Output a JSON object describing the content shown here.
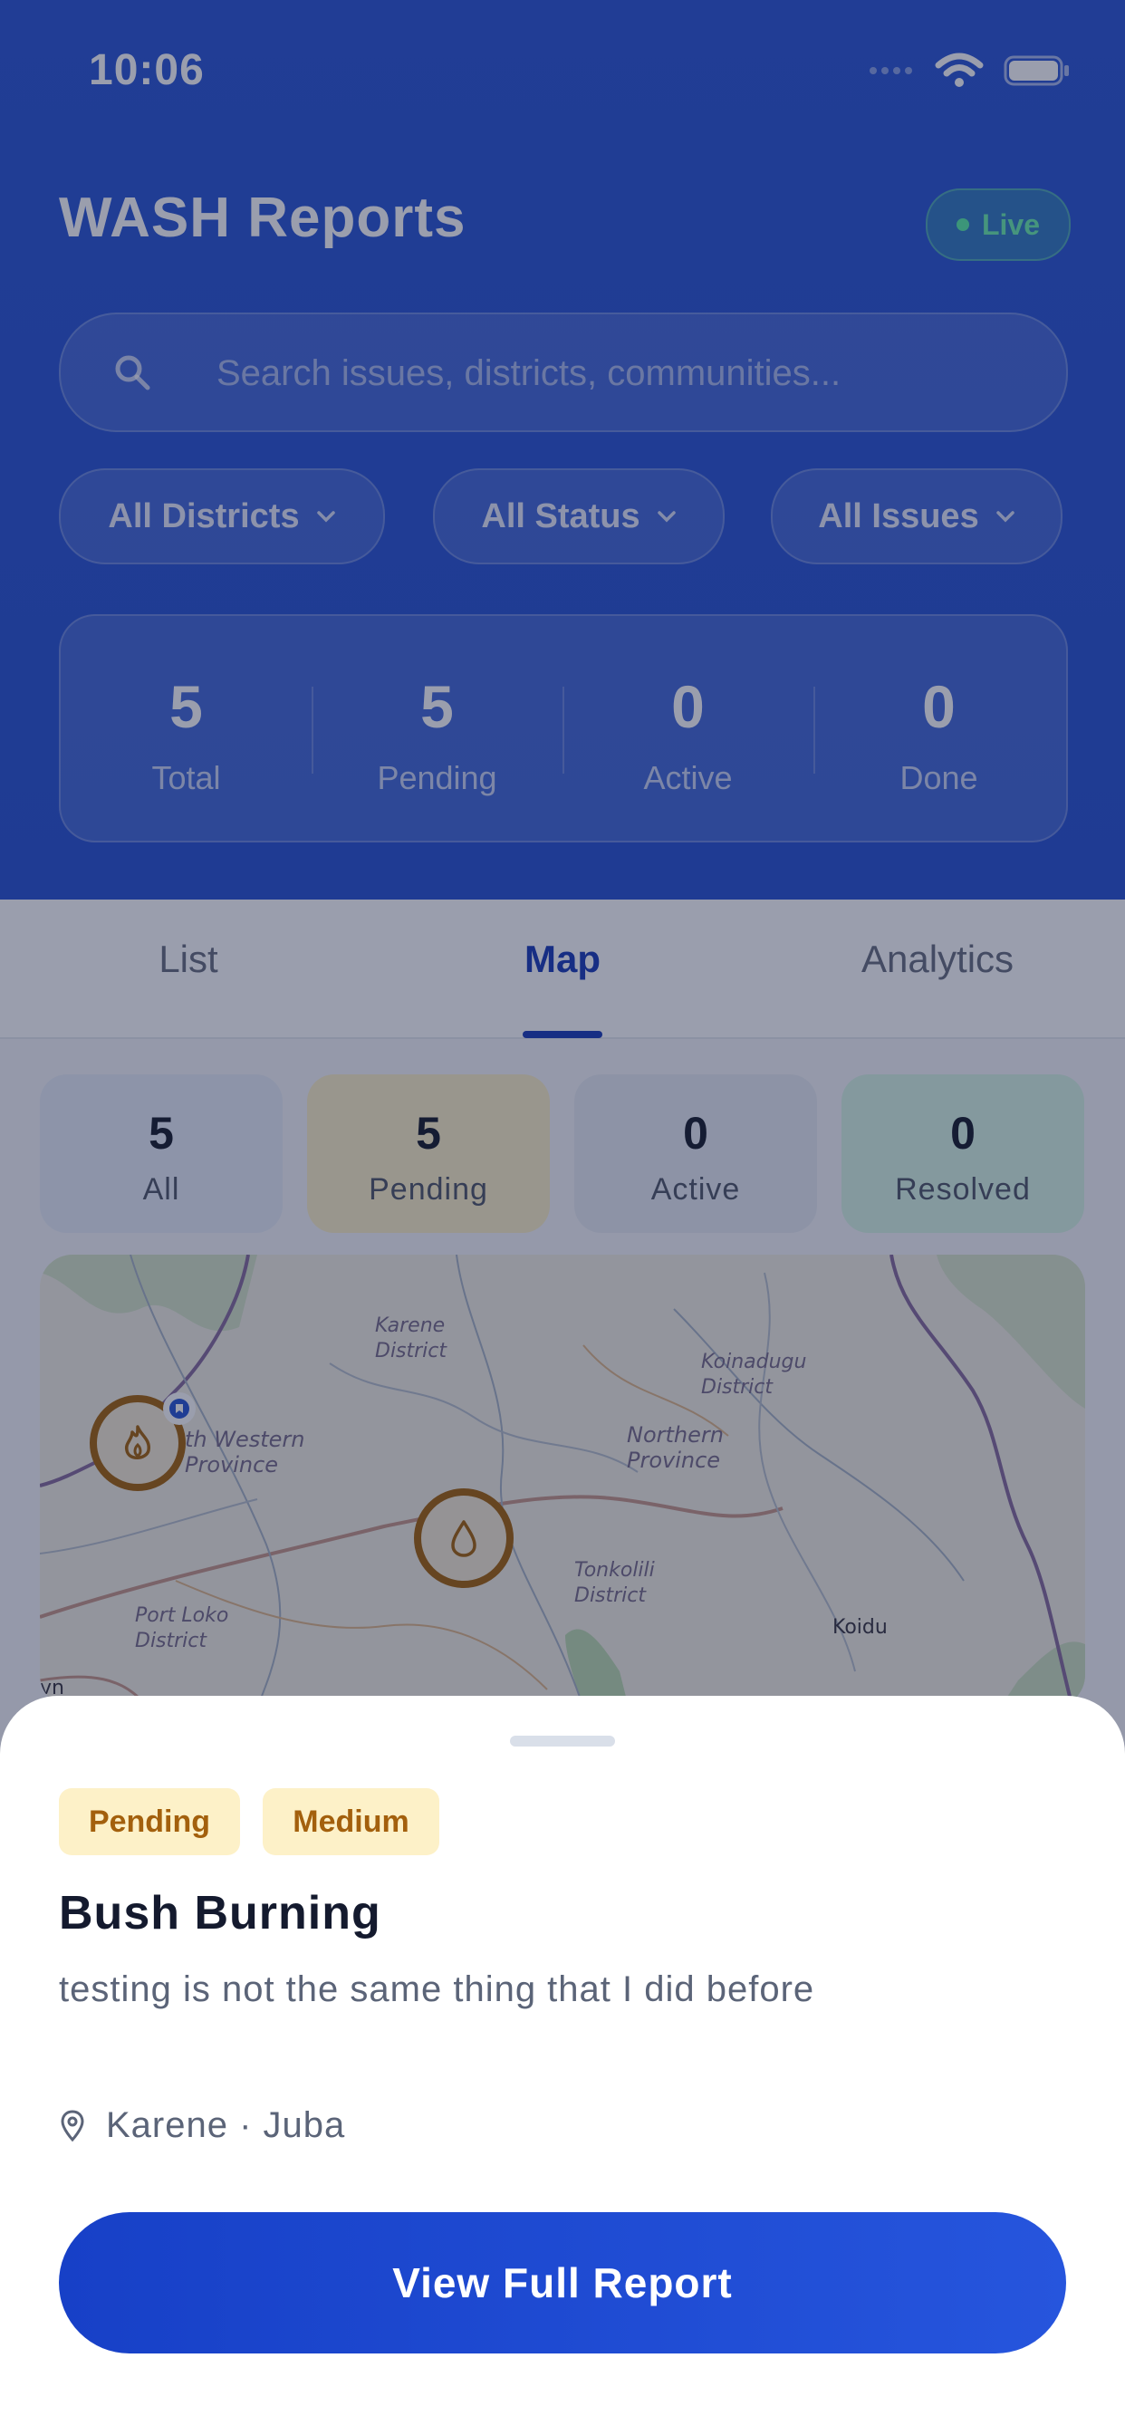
{
  "status_bar": {
    "time": "10:06"
  },
  "header": {
    "title": "WASH Reports",
    "live_label": "Live",
    "search_placeholder": "Search issues, districts, communities...",
    "filters": [
      {
        "label": "All Districts"
      },
      {
        "label": "All Status"
      },
      {
        "label": "All Issues"
      }
    ],
    "stats": [
      {
        "value": "5",
        "label": "Total"
      },
      {
        "value": "5",
        "label": "Pending"
      },
      {
        "value": "0",
        "label": "Active"
      },
      {
        "value": "0",
        "label": "Done"
      }
    ]
  },
  "tabs": [
    {
      "label": "List",
      "active": false
    },
    {
      "label": "Map",
      "active": true
    },
    {
      "label": "Analytics",
      "active": false
    }
  ],
  "summary": [
    {
      "value": "5",
      "label": "All",
      "color": "#e8eef8"
    },
    {
      "value": "5",
      "label": "Pending",
      "color": "#fdf1c8"
    },
    {
      "value": "0",
      "label": "Active",
      "color": "#e9edf3"
    },
    {
      "value": "0",
      "label": "Resolved",
      "color": "#d9f6e6"
    }
  ],
  "map": {
    "labels": {
      "karene": "Karene\nDistrict",
      "koinadugu": "Koinadugu\nDistrict",
      "north_western": "th Western\nProvince",
      "northern": "Northern\nProvince",
      "tonkolili": "Tonkolili\nDistrict",
      "port_loko": "Port Loko\nDistrict",
      "koidu": "Koidu",
      "edge": "vn"
    },
    "markers": [
      {
        "icon": "fire-icon"
      },
      {
        "icon": "water-drop-icon"
      }
    ]
  },
  "sheet": {
    "status_badge": "Pending",
    "priority_badge": "Medium",
    "title": "Bush Burning",
    "description": "testing is not the same thing that I did before",
    "location": "Karene · Juba",
    "cta_label": "View Full Report"
  },
  "colors": {
    "primary": "#2b55d2",
    "accent_blue": "#1e3fb8",
    "live_green": "#5df0a5",
    "pending_bg": "#fdf1c8",
    "pending_text": "#a3600d",
    "marker_ring": "#a5660f"
  }
}
